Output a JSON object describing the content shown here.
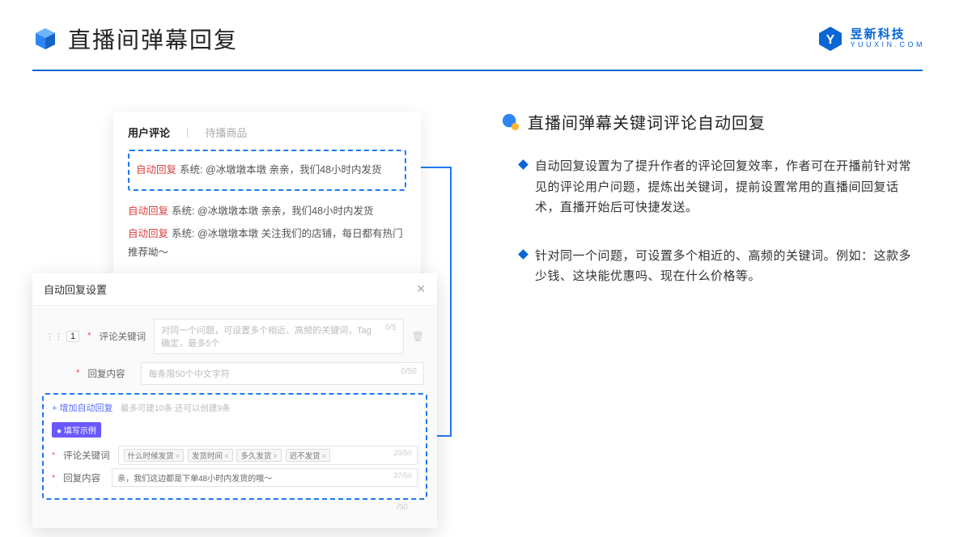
{
  "header": {
    "title": "直播间弹幕回复"
  },
  "brand": {
    "cn": "昱新科技",
    "en": "Y U U X I N . C O M"
  },
  "cardTabs": {
    "active": "用户评论",
    "inactive": "待播商品"
  },
  "comments": {
    "c1_tag": "自动回复",
    "c1_rest": "系统: @冰墩墩本墩 亲亲，我们48小时内发货",
    "c2_tag": "自动回复",
    "c2_rest": "系统: @冰墩墩本墩 亲亲，我们48小时内发货",
    "c3_tag": "自动回复",
    "c3_rest": "系统: @冰墩墩本墩 关注我们的店铺，每日都有热门推荐呦～"
  },
  "settings": {
    "title": "自动回复设置",
    "num": "1",
    "labelKeyword": "评论关键词",
    "placeholderKeyword": "对同一个问题，可设置多个相近、高频的关键词，Tag确定，最多5个",
    "countKeyword": "0/5",
    "labelReply": "回复内容",
    "placeholderReply": "每条限50个中文字符",
    "countReply": "0/50",
    "addLink": "+ 增加自动回复",
    "addNote": "最多可建10条 还可以创建9条",
    "exBadge": "● 填写示例",
    "exLabelKeyword": "评论关键词",
    "exTag1": "什么时候发货",
    "exTag2": "发货时间",
    "exTag3": "多久发货",
    "exTag4": "迟不发货",
    "exCountKw": "20/50",
    "exLabelReply": "回复内容",
    "exReplyVal": "亲，我们这边都是下单48小时内发货的哦～",
    "exCountReply": "37/50",
    "belowCount": "/50"
  },
  "right": {
    "secTitle": "直播间弹幕关键词评论自动回复",
    "b1": "自动回复设置为了提升作者的评论回复效率，作者可在开播前针对常见的评论用户问题，提炼出关键词，提前设置常用的直播间回复话术，直播开始后可快捷发送。",
    "b2": "针对同一个问题，可设置多个相近的、高频的关键词。例如：这款多少钱、这块能优惠吗、现在什么价格等。"
  }
}
